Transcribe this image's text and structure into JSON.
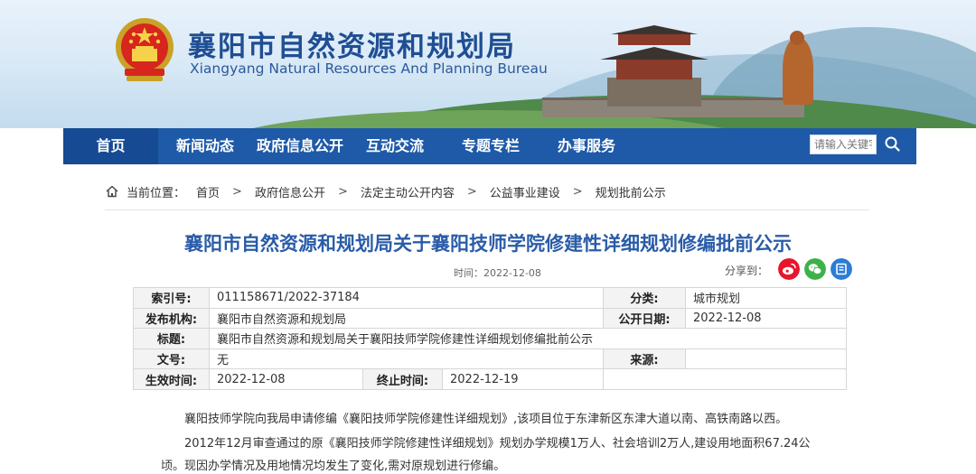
{
  "site": {
    "title_cn": "襄阳市自然资源和规划局",
    "title_en": "Xiangyang Natural Resources And Planning Bureau"
  },
  "nav": {
    "items": [
      "首页",
      "新闻动态",
      "政府信息公开",
      "互动交流",
      "专题专栏",
      "办事服务"
    ],
    "search_placeholder": "请输入关键字"
  },
  "breadcrumb": {
    "label": "当前位置：",
    "items": [
      "首页",
      "政府信息公开",
      "法定主动公开内容",
      "公益事业建设",
      "规划批前公示"
    ]
  },
  "article": {
    "title": "襄阳市自然资源和规划局关于襄阳技师学院修建性详细规划修编批前公示",
    "date": "时间：2022-12-08",
    "share_label": "分享到："
  },
  "info": {
    "index_label": "索引号:",
    "index_value": "011158671/2022-37184",
    "category_label": "分类:",
    "category_value": "城市规划",
    "publisher_label": "发布机构:",
    "publisher_value": "襄阳市自然资源和规划局",
    "pubdate_label": "公开日期:",
    "pubdate_value": "2022-12-08",
    "subject_label": "标题:",
    "subject_value": "襄阳市自然资源和规划局关于襄阳技师学院修建性详细规划修编批前公示",
    "docno_label": "文号:",
    "docno_value": "无",
    "source_label": "来源:",
    "source_value": "",
    "effective_label": "生效时间:",
    "effective_value": "2022-12-08",
    "end_label": "终止时间:",
    "end_value": "2022-12-19"
  },
  "body": {
    "p1": "襄阳技师学院向我局申请修编《襄阳技师学院修建性详细规划》,该项目位于东津新区东津大道以南、高铁南路以西。",
    "p2a": "2012年12月审查通过的原《襄阳技师学院修建性详细规划》规划办学规模1万人、社会培训2万人,建设用地面积67.24公",
    "p2b": "顷。现因办学情况及用地情况均发生了变化,需对原规划进行修编。"
  },
  "colors": {
    "brand": "#1e5aa8",
    "title": "#2a5ca8",
    "weibo": "#e6162d",
    "wechat": "#3fb14b",
    "qzone": "#2d7cd6"
  }
}
